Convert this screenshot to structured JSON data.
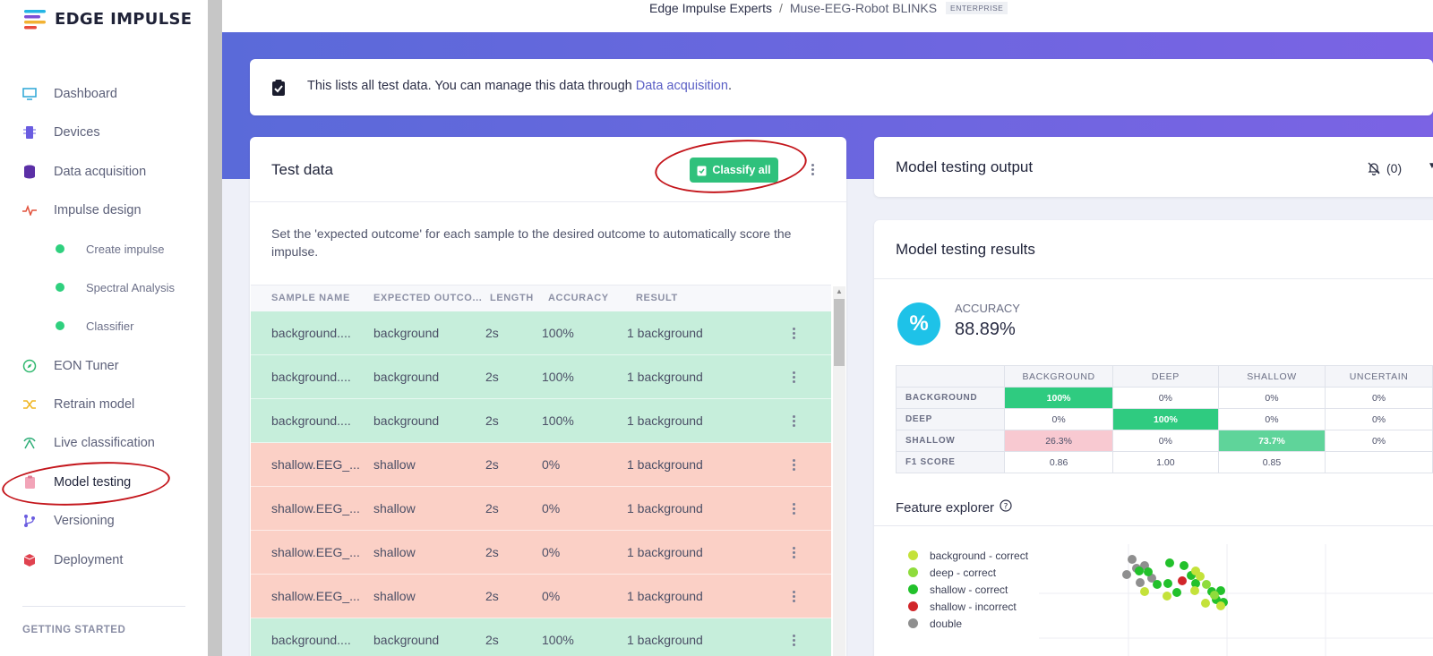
{
  "brand": {
    "name": "EDGE IMPULSE"
  },
  "breadcrumb": {
    "org": "Edge Impulse Experts",
    "separator": "/",
    "project": "Muse-EEG-Robot BLINKS",
    "badge": "ENTERPRISE"
  },
  "sidebar": {
    "items": [
      {
        "label": "Dashboard",
        "icon": "monitor-icon"
      },
      {
        "label": "Devices",
        "icon": "chip-icon"
      },
      {
        "label": "Data acquisition",
        "icon": "database-icon"
      },
      {
        "label": "Impulse design",
        "icon": "pulse-icon"
      },
      {
        "label": "EON Tuner",
        "icon": "compass-icon"
      },
      {
        "label": "Retrain model",
        "icon": "shuffle-icon"
      },
      {
        "label": "Live classification",
        "icon": "signal-icon"
      },
      {
        "label": "Model testing",
        "icon": "clipboard-icon"
      },
      {
        "label": "Versioning",
        "icon": "branch-icon"
      },
      {
        "label": "Deployment",
        "icon": "cube-icon"
      }
    ],
    "sub_items": [
      {
        "label": "Create impulse"
      },
      {
        "label": "Spectral Analysis"
      },
      {
        "label": "Classifier"
      }
    ],
    "section_label": "GETTING STARTED"
  },
  "info": {
    "text": "This lists all test data. You can manage this data through ",
    "link": "Data acquisition",
    "suffix": "."
  },
  "test_data": {
    "title": "Test data",
    "classify_button": "Classify all",
    "hint": "Set the 'expected outcome' for each sample to the desired outcome to automatically score the impulse.",
    "columns": [
      "SAMPLE NAME",
      "EXPECTED OUTCO...",
      "LENGTH",
      "ACCURACY",
      "RESULT"
    ],
    "rows": [
      {
        "name": "background....",
        "expected": "background",
        "length": "2s",
        "accuracy": "100%",
        "result": "1 background",
        "status": "correct"
      },
      {
        "name": "background....",
        "expected": "background",
        "length": "2s",
        "accuracy": "100%",
        "result": "1 background",
        "status": "correct"
      },
      {
        "name": "background....",
        "expected": "background",
        "length": "2s",
        "accuracy": "100%",
        "result": "1 background",
        "status": "correct"
      },
      {
        "name": "shallow.EEG_...",
        "expected": "shallow",
        "length": "2s",
        "accuracy": "0%",
        "result": "1 background",
        "status": "incorrect"
      },
      {
        "name": "shallow.EEG_...",
        "expected": "shallow",
        "length": "2s",
        "accuracy": "0%",
        "result": "1 background",
        "status": "incorrect"
      },
      {
        "name": "shallow.EEG_...",
        "expected": "shallow",
        "length": "2s",
        "accuracy": "0%",
        "result": "1 background",
        "status": "incorrect"
      },
      {
        "name": "shallow.EEG_...",
        "expected": "shallow",
        "length": "2s",
        "accuracy": "0%",
        "result": "1 background",
        "status": "incorrect"
      },
      {
        "name": "background....",
        "expected": "background",
        "length": "2s",
        "accuracy": "100%",
        "result": "1 background",
        "status": "correct"
      }
    ]
  },
  "model_output": {
    "title": "Model testing output",
    "notifications": "(0)"
  },
  "results": {
    "title": "Model testing results",
    "accuracy_label": "ACCURACY",
    "accuracy_value": "88.89%",
    "accuracy_icon": "%",
    "matrix": {
      "columns": [
        "BACKGROUND",
        "DEEP",
        "SHALLOW",
        "UNCERTAIN"
      ],
      "rows": [
        {
          "label": "BACKGROUND",
          "cells": [
            "100%",
            "0%",
            "0%",
            "0%"
          ]
        },
        {
          "label": "DEEP",
          "cells": [
            "0%",
            "100%",
            "0%",
            "0%"
          ]
        },
        {
          "label": "SHALLOW",
          "cells": [
            "26.3%",
            "0%",
            "73.7%",
            "0%"
          ]
        },
        {
          "label": "F1 SCORE",
          "cells": [
            "0.86",
            "1.00",
            "0.85",
            ""
          ]
        }
      ]
    },
    "feature_explorer": {
      "title": "Feature explorer",
      "legend": [
        {
          "label": "background - correct",
          "color": "#c4e23a"
        },
        {
          "label": "deep - correct",
          "color": "#8fdc3c"
        },
        {
          "label": "shallow - correct",
          "color": "#22c12b"
        },
        {
          "label": "shallow - incorrect",
          "color": "#d1262a"
        },
        {
          "label": "double",
          "color": "#8f8f8f"
        }
      ]
    }
  },
  "colors": {
    "accent": "#2fc17c",
    "correct_row": "#c6eedb",
    "incorrect_row": "#fbd0c6",
    "hero_start": "#5a6ad9",
    "hero_end": "#7b63e4"
  }
}
